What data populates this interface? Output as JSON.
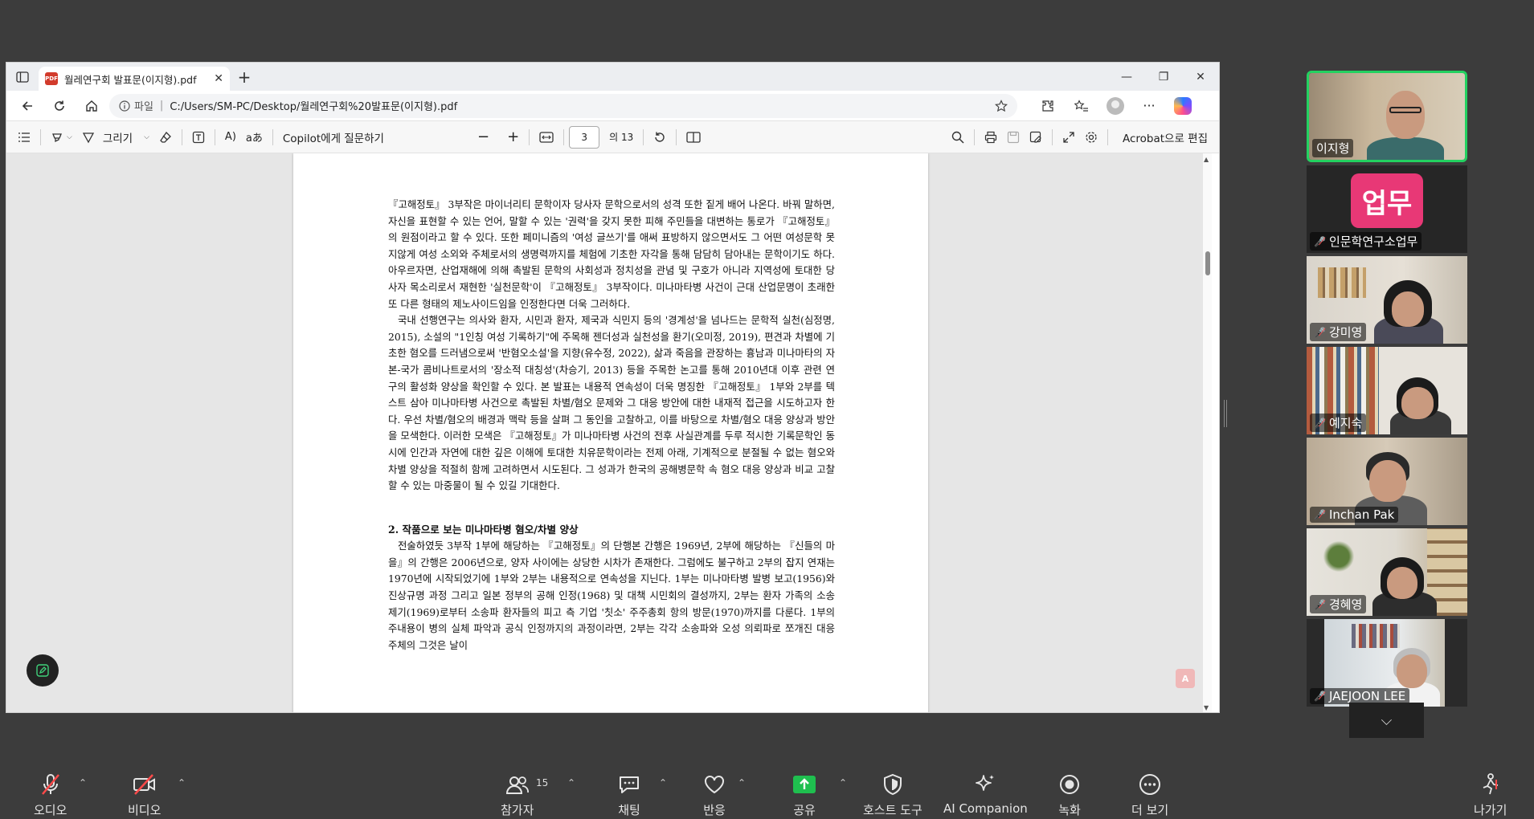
{
  "browser": {
    "tab_title": "월레연구회 발표문(이지형).pdf",
    "address": {
      "info_label": "파일",
      "url": "C:/Users/SM-PC/Desktop/월레연구회%20발표문(이지형).pdf"
    }
  },
  "pdf_toolbar": {
    "draw_label": "그리기",
    "copilot_label": "Copilot에게 질문하기",
    "current_page": "3",
    "total_pages": "의 13",
    "acrobat_label": "Acrobat으로 편집"
  },
  "document": {
    "paragraphs": [
      "『고해정토』 3부작은 마이너리티 문학이자 당사자 문학으로서의 성격 또한 짙게 배어 나온다. 바꿔 말하면, 자신을 표현할 수 있는 언어, 말할 수 있는 '권력'을 갖지 못한 피해 주민들을 대변하는 통로가 『고해정토』의 원점이라고 할 수 있다. 또한 페미니즘의 '여성 글쓰기'를 애써 표방하지 않으면서도 그 어떤 여성문학 못지않게 여성 소외와 주체로서의 생명력까지를 체험에 기초한 자각을 통해 담담히 담아내는 문학이기도 하다. 아우르자면, 산업재해에 의해 촉발된 문학의 사회성과 정치성을 관념 및 구호가 아니라 지역성에 토대한 당사자 목소리로서 재현한 '실천문학'이 『고해정토』 3부작이다. 미나마타병 사건이 근대 산업문명이 초래한 또 다른 형태의 제노사이드임을 인정한다면 더욱 그러하다.",
      "국내 선행연구는 의사와 환자, 시민과 환자, 제국과 식민지 등의 '경계성'을 넘나드는 문학적 실천(심정명, 2015), 소설의 \"1인칭 여성 기록하기\"에 주목해 젠더성과 실천성을 환기(오미정, 2019), 편견과 차별에 기초한 혐오를 드러냄으로써 '반혐오소설'을 지향(유수정, 2022), 삶과 죽음을 관장하는 흉남과 미나마타의 자본-국가 콤비나트로서의 '장소적 대칭성'(차승기, 2013) 등을 주목한 논고를 통해 2010년대 이후 관련 연구의 활성화 양상을 확인할 수 있다. 본 발표는 내용적 연속성이 더욱 명징한 『고해정토』 1부와 2부를 텍스트 삼아 미나마타병 사건으로 촉발된 차별/혐오 문제와 그 대응 방안에 대한 내재적 접근을 시도하고자 한다. 우선 차별/혐오의 배경과 맥락 등을 살펴 그 동인을 고찰하고, 이를 바탕으로 차별/혐오 대응 양상과 방안을 모색한다. 이러한 모색은 『고해정토』가 미나마타병 사건의 전후 사실관계를 두루 적시한 기록문학인 동시에 인간과 자연에 대한 깊은 이해에 토대한 치유문학이라는 전제 아래, 기계적으로 분절될 수 없는 혐오와 차별 양상을 적절히 함께 고려하면서 시도된다. 그 성과가 한국의 공해병문학 속 혐오 대응 양상과 비교 고찰할 수 있는 마중물이 될 수 있길 기대한다."
    ],
    "section_heading": "2. 작품으로 보는 미나마타병 혐오/차별 양상",
    "section_paragraph": "전술하였듯 3부작 1부에 해당하는 『고해정토』의 단행본 간행은 1969년, 2부에 해당하는 『신들의 마을』의 간행은 2006년으로, 양자 사이에는 상당한 시차가 존재한다. 그럼에도 불구하고 2부의 잡지 연재는 1970년에 시작되었기에 1부와 2부는 내용적으로 연속성을 지닌다. 1부는 미나마타병 발병 보고(1956)와 진상규명 과정 그리고 일본 정부의 공해 인정(1968) 및 대책 시민회의 결성까지, 2부는 환자 가족의 소송 제기(1969)로부터 소송파 환자들의 피고 측 기업 '칫소' 주주총회 항의 방문(1970)까지를 다룬다. 1부의 주내용이 병의 실체 파악과 공식 인정까지의 과정이라면, 2부는 각각 소송파와 오성 의뢰파로 쪼개진 대응 주체의 그것은 날이"
  },
  "participants": [
    {
      "name": "이지형",
      "muted": false
    },
    {
      "name": "인문학연구소업무",
      "avatar_text": "업무",
      "muted": true
    },
    {
      "name": "강미영",
      "muted": true
    },
    {
      "name": "예지숙",
      "muted": true
    },
    {
      "name": "Inchan Pak",
      "muted": true
    },
    {
      "name": "경혜영",
      "muted": true
    },
    {
      "name": "JAEJOON LEE",
      "muted": true
    }
  ],
  "meeting_toolbar": {
    "audio": "오디오",
    "video": "비디오",
    "participants": "참가자",
    "participants_count": "15",
    "chat": "채팅",
    "reactions": "반응",
    "share": "공유",
    "host_tools": "호스트 도구",
    "ai_companion": "AI Companion",
    "record": "녹화",
    "more": "더 보기",
    "leave": "나가기"
  },
  "colors": {
    "accent_green": "#23d160",
    "share_green": "#1fbf4f",
    "mute_red": "#ff4a4a",
    "avatar_pink": "#e83876"
  }
}
